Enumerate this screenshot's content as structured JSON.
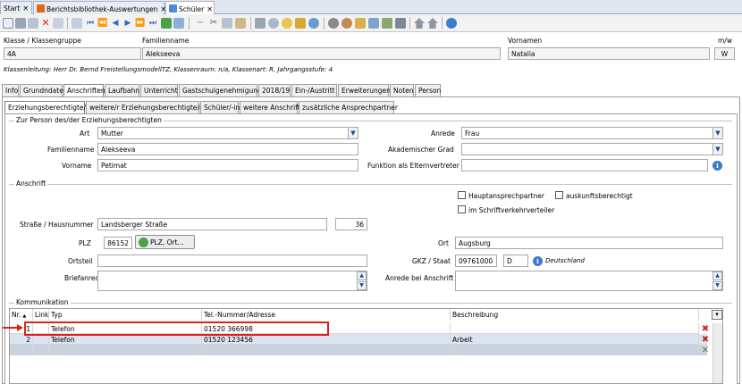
{
  "tabs": [
    {
      "label": "Start"
    },
    {
      "label": "Berichtsbibliothek-Auswertungen"
    },
    {
      "label": "Schüler"
    }
  ],
  "header": {
    "klasse_label": "Klasse / Klassengruppe",
    "klasse_value": "4A",
    "familienname_label": "Familienname",
    "familienname_value": "Alekseeva",
    "vornamen_label": "Vornamen",
    "vornamen_value": "Natalia",
    "mw_label": "m/w",
    "mw_value": "W",
    "info_line": "Klassenleitung: Herr Dr. Bernd FreistellungsmodellTZ, Klassenraum: n/a, Klassenart: R, Jahrgangsstufe: 4"
  },
  "main_tabs": [
    {
      "label": "Info"
    },
    {
      "label": "Grundndaten"
    },
    {
      "label": "Anschriften"
    },
    {
      "label": "Laufbahn"
    },
    {
      "label": "Unterricht"
    },
    {
      "label": "Gastschulgenehmigung"
    },
    {
      "label": "2018/19"
    },
    {
      "label": "Ein-/Austritt"
    },
    {
      "label": "Erweiterungen"
    },
    {
      "label": "Noten"
    },
    {
      "label": "Person"
    }
  ],
  "sub_tabs": [
    {
      "label": "Erziehungsberechtigte/r"
    },
    {
      "label": "weitere/r Erziehungsberechtigte/r"
    },
    {
      "label": "Schüler/-in"
    },
    {
      "label": "weitere Anschrift"
    },
    {
      "label": "zusätzliche Ansprechpartner"
    }
  ],
  "person": {
    "group_title": "Zur Person des/der Erziehungsberechtigten",
    "art_label": "Art",
    "art_value": "Mutter",
    "anrede_label": "Anrede",
    "anrede_value": "Frau",
    "familienname_label": "Familienname",
    "familienname_value": "Alekseeva",
    "akademischer_grad_label": "Akademischer Grad",
    "akademischer_grad_value": "",
    "vorname_label": "Vorname",
    "vorname_value": "Petimat",
    "funktion_label": "Funktion als Elternvertreter",
    "funktion_value": ""
  },
  "anschrift": {
    "group_title": "Anschrift",
    "hauptansprechpartner": "Hauptansprechpartner",
    "auskunftsberechtigt": "auskunftsberechtigt",
    "schriftverkehr": "im Schriftverkehrverteiler",
    "strasse_label": "Straße / Hausnummer",
    "strasse_value": "Landsberger Straße",
    "hausnummer_value": "36",
    "plz_label": "PLZ",
    "plz_value": "86152",
    "plz_button": "PLZ, Ort...",
    "ort_label": "Ort",
    "ort_value": "Augsburg",
    "ortsteil_label": "Ortsteil",
    "ortsteil_value": "",
    "gkz_label": "GKZ / Staat",
    "gkz_value": "09761000",
    "staat_value": "D",
    "staat_name": "Deutschland",
    "briefanrede_label": "Briefanrede",
    "briefanrede_value": "",
    "anrede_anschrift_label": "Anrede bei Anschrift",
    "anrede_anschrift_value": ""
  },
  "kommunikation": {
    "group_title": "Kommunikation",
    "columns": {
      "nr": "Nr.",
      "link": "Link",
      "typ": "Typ",
      "tel": "Tel.-Nummer/Adresse",
      "beschreibung": "Beschreibung"
    },
    "rows": [
      {
        "nr": "1",
        "typ": "Telefon",
        "tel": "01520 366998",
        "beschreibung": ""
      },
      {
        "nr": "2",
        "typ": "Telefon",
        "tel": "01520 123456",
        "beschreibung": "Arbeit"
      }
    ]
  },
  "colors": {
    "highlight": "#e0201c",
    "accent": "#3b7bc8"
  }
}
